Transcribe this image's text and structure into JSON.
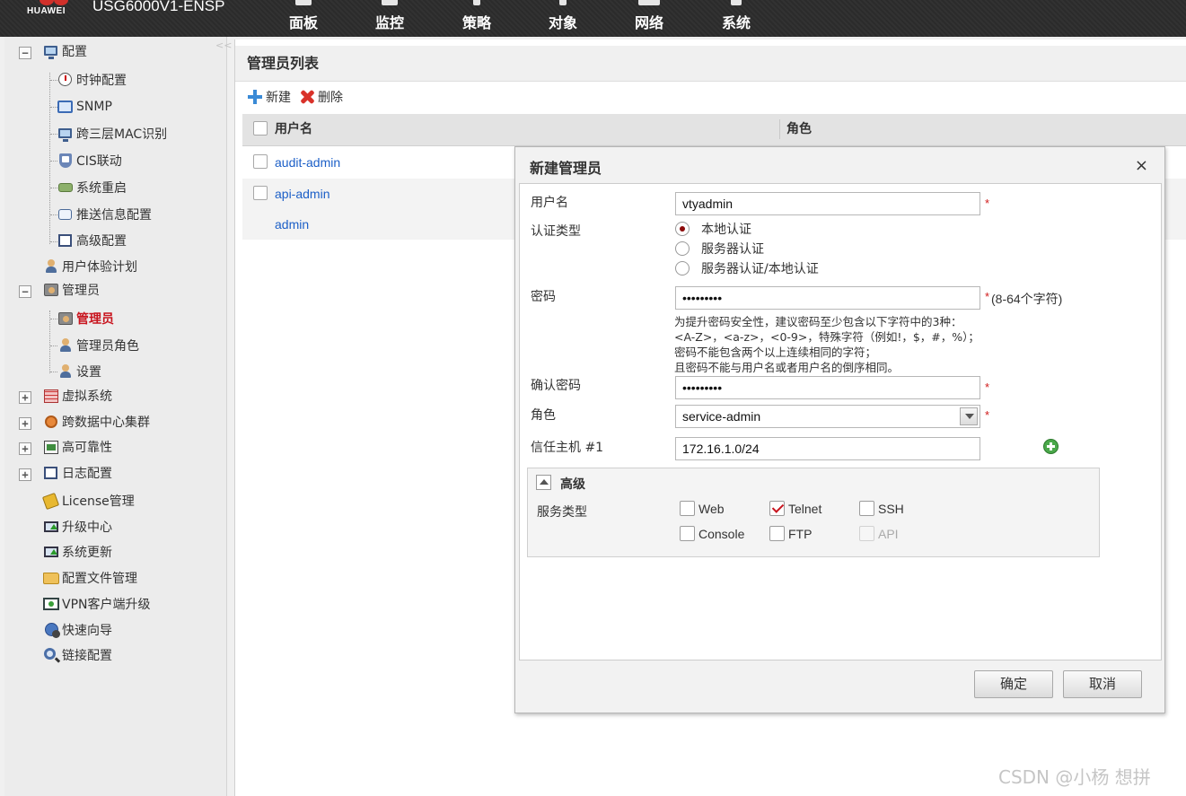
{
  "header": {
    "brand": "HUAWEI",
    "product": "USG6000V1-ENSP",
    "nav": [
      {
        "label": "面板",
        "icon": "dashboard-icon"
      },
      {
        "label": "监控",
        "icon": "monitor-icon"
      },
      {
        "label": "策略",
        "icon": "policy-icon"
      },
      {
        "label": "对象",
        "icon": "object-icon"
      },
      {
        "label": "网络",
        "icon": "network-icon"
      },
      {
        "label": "系统",
        "icon": "system-icon"
      }
    ],
    "active_nav": "系统"
  },
  "sidebar": {
    "collapse_glyph": "<<",
    "items": [
      {
        "label": "配置",
        "icon": "config-icon",
        "expanded": true
      },
      {
        "label": "时钟配置",
        "icon": "clock-icon"
      },
      {
        "label": "SNMP",
        "icon": "snmp-icon"
      },
      {
        "label": "跨三层MAC识别",
        "icon": "mac-icon"
      },
      {
        "label": "CIS联动",
        "icon": "cis-icon"
      },
      {
        "label": "系统重启",
        "icon": "restart-icon"
      },
      {
        "label": "推送信息配置",
        "icon": "push-icon"
      },
      {
        "label": "高级配置",
        "icon": "advanced-icon"
      },
      {
        "label": "用户体验计划",
        "icon": "user-experience-icon"
      },
      {
        "label": "管理员",
        "icon": "admin-group-icon",
        "expanded": true
      },
      {
        "label": "管理员",
        "icon": "admin-icon",
        "active": true
      },
      {
        "label": "管理员角色",
        "icon": "admin-role-icon"
      },
      {
        "label": "设置",
        "icon": "settings-icon"
      },
      {
        "label": "虚拟系统",
        "icon": "virtual-system-icon",
        "expanded": false
      },
      {
        "label": "跨数据中心集群",
        "icon": "cluster-icon",
        "expanded": false
      },
      {
        "label": "高可靠性",
        "icon": "ha-icon",
        "expanded": false
      },
      {
        "label": "日志配置",
        "icon": "log-icon",
        "expanded": false
      },
      {
        "label": "License管理",
        "icon": "license-icon"
      },
      {
        "label": "升级中心",
        "icon": "upgrade-icon"
      },
      {
        "label": "系统更新",
        "icon": "update-icon"
      },
      {
        "label": "配置文件管理",
        "icon": "folder-icon"
      },
      {
        "label": "VPN客户端升级",
        "icon": "vpn-icon"
      },
      {
        "label": "快速向导",
        "icon": "wizard-icon"
      },
      {
        "label": "链接配置",
        "icon": "link-icon"
      }
    ]
  },
  "main": {
    "title": "管理员列表",
    "toolbar": {
      "new_label": "新建",
      "delete_label": "删除"
    },
    "table": {
      "columns": [
        "用户名",
        "角色"
      ],
      "rows": [
        {
          "username": "audit-admin",
          "checkbox": true
        },
        {
          "username": "api-admin",
          "checkbox": true
        },
        {
          "username": "admin",
          "checkbox": false
        }
      ]
    }
  },
  "dialog": {
    "title": "新建管理员",
    "close_glyph": "×",
    "required_mark": "*",
    "username": {
      "label": "用户名",
      "value": "vtyadmin"
    },
    "auth_type": {
      "label": "认证类型",
      "options": [
        "本地认证",
        "服务器认证",
        "服务器认证/本地认证"
      ],
      "selected": 0
    },
    "password": {
      "label": "密码",
      "value": "•••••••••",
      "length_hint": "(8-64个字符)"
    },
    "password_hint": [
      "为提升密码安全性，建议密码至少包含以下字符中的3种：",
      "<A-Z>，<a-z>，<0-9>，特殊字符（例如!，$，#，%）；",
      "密码不能包含两个以上连续相同的字符；",
      "且密码不能与用户名或者用户名的倒序相同。"
    ],
    "confirm_password": {
      "label": "确认密码",
      "value": "•••••••••"
    },
    "role": {
      "label": "角色",
      "value": "service-admin"
    },
    "trusted_host": {
      "label": "信任主机 #1",
      "value": "172.16.1.0/24"
    },
    "advanced": {
      "title": "高级",
      "service_label": "服务类型",
      "services": [
        {
          "label": "Web",
          "checked": false,
          "disabled": false
        },
        {
          "label": "Telnet",
          "checked": true,
          "disabled": false
        },
        {
          "label": "SSH",
          "checked": false,
          "disabled": false
        },
        {
          "label": "Console",
          "checked": false,
          "disabled": false
        },
        {
          "label": "FTP",
          "checked": false,
          "disabled": false
        },
        {
          "label": "API",
          "checked": false,
          "disabled": true
        }
      ]
    },
    "ok_label": "确定",
    "cancel_label": "取消"
  },
  "watermark": "CSDN @小杨 想拼"
}
